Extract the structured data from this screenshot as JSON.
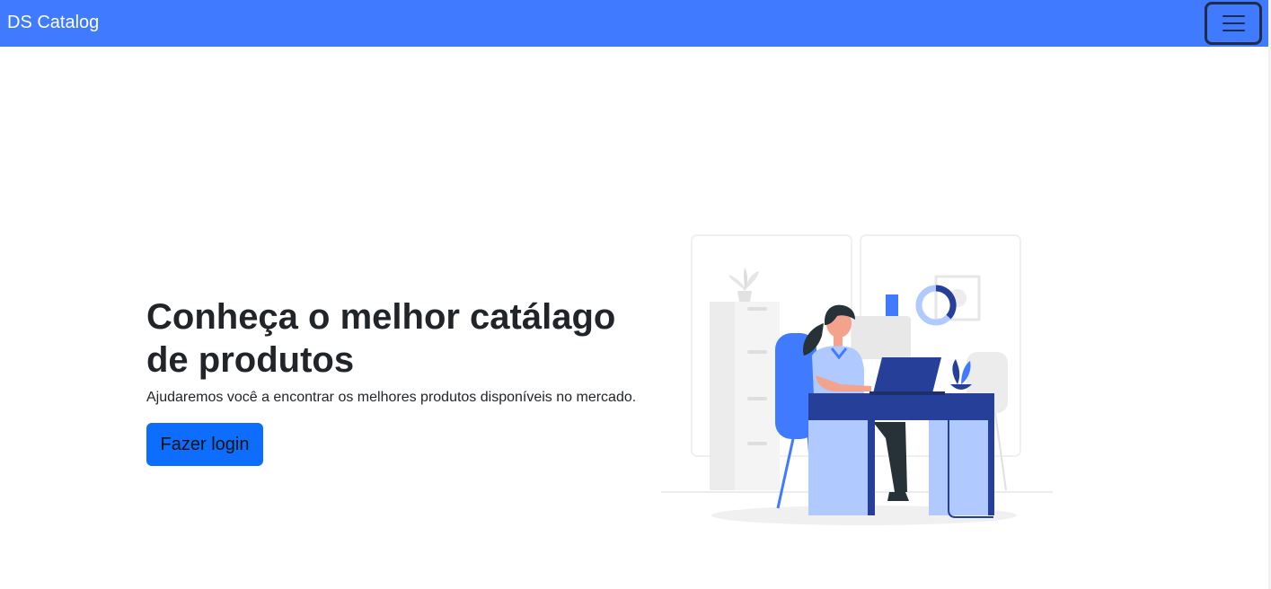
{
  "navbar": {
    "brand": "DS Catalog",
    "toggler_icon": "hamburger-menu-icon"
  },
  "hero": {
    "title": "Conheça o melhor catálago de produtos",
    "subtitle": "Ajudaremos você a encontrar os melhores produtos disponíveis no mercado.",
    "login_button": "Fazer login"
  },
  "colors": {
    "primary": "#407bff",
    "button": "#0d6efd",
    "dark_blue": "#263f99",
    "light_blue": "#b0c9ff",
    "text": "#212529"
  }
}
